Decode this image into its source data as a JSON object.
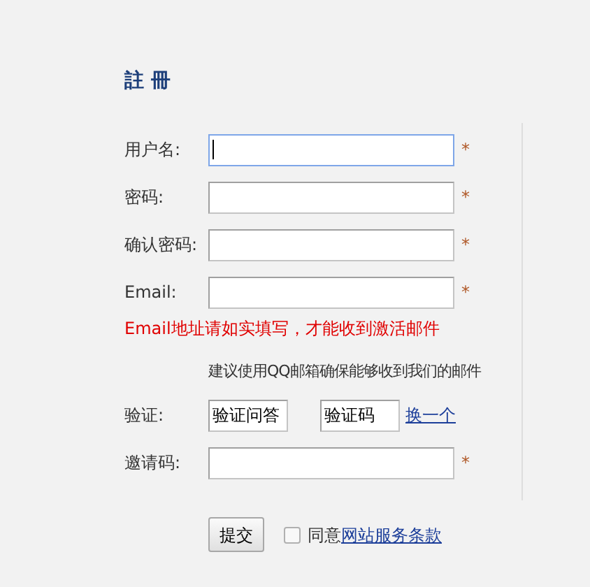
{
  "title": "註 冊",
  "fields": [
    {
      "label": "用户名:",
      "required": "*",
      "focused": true
    },
    {
      "label": "密码:",
      "required": "*",
      "focused": false
    },
    {
      "label": "确认密码:",
      "required": "*",
      "focused": false
    },
    {
      "label": "Email:",
      "required": "*",
      "focused": false
    }
  ],
  "email_notice": "Email地址请如实填写，才能收到激活邮件",
  "email_hint": "建议使用QQ邮箱确保能够收到我们的邮件",
  "verify": {
    "label": "验证:",
    "question_value": "验证问答",
    "code_value": "验证码",
    "refresh_link": "换一个"
  },
  "invite": {
    "label": "邀请码:",
    "required": "*",
    "focused": false
  },
  "submit_button": "提交",
  "agree": {
    "checked": false,
    "text": "同意",
    "link": "网站服务条款"
  }
}
